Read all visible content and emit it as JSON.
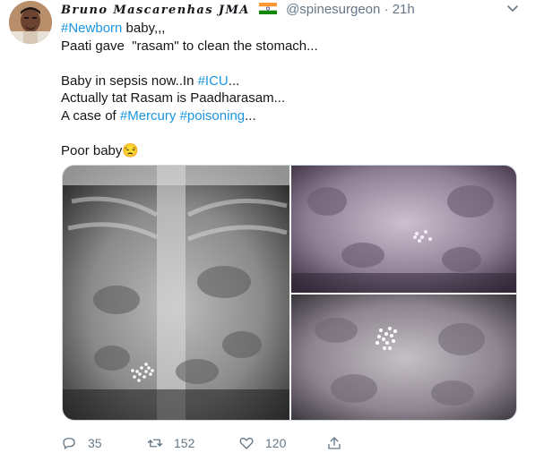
{
  "author": {
    "display_name": "Bruno Mascarenhas JMA",
    "handle": "@spinesurgeon",
    "separator": "·",
    "time": "21h",
    "flag_icon": "india-flag-icon"
  },
  "tweet": {
    "line1_tag": "#Newborn",
    "line1_rest": " baby,,,",
    "line2": "Paati gave  \"rasam\" to clean the stomach...",
    "line3_pre": "Baby in sepsis now..In ",
    "line3_tag": "#ICU",
    "line3_post": "...",
    "line4": "Actually tat Rasam is Paadharasam...",
    "line5_pre": "A case of ",
    "line5_tag1": "#Mercury",
    "line5_tag2": "#poisoning",
    "line5_post": "...",
    "line6": "Poor baby",
    "emoji": "😒"
  },
  "media": {
    "images": [
      "abdominal-xray-main",
      "abdominal-xray-top-right",
      "abdominal-xray-bottom-right"
    ]
  },
  "actions": {
    "replies": "35",
    "retweets": "152",
    "likes": "120"
  },
  "colors": {
    "link": "#1b95e0",
    "muted": "#657786"
  }
}
